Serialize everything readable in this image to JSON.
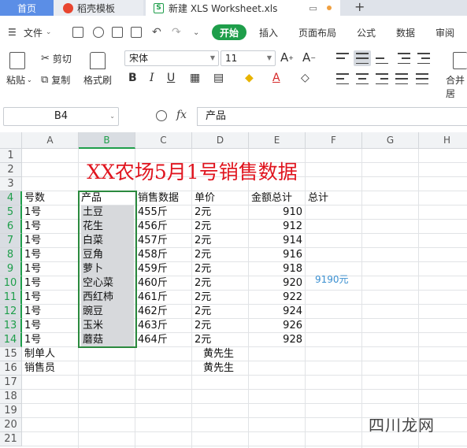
{
  "tabs": {
    "home": "首页",
    "template": "稻壳模板",
    "document": "新建 XLS Worksheet.xls"
  },
  "menu": {
    "file": "文件",
    "items": [
      "开始",
      "插入",
      "页面布局",
      "公式",
      "数据",
      "审阅"
    ]
  },
  "ribbon": {
    "paste": "粘贴",
    "cut": "剪切",
    "copy": "复制",
    "format_painter": "格式刷",
    "font_name": "宋体",
    "font_size": "11",
    "merge": "合并居"
  },
  "formula_bar": {
    "cell_ref": "B4",
    "fx": "fx",
    "content": "产品"
  },
  "columns": [
    "A",
    "B",
    "C",
    "D",
    "E",
    "F",
    "G",
    "H"
  ],
  "rows": [
    "1",
    "2",
    "3",
    "4",
    "5",
    "6",
    "7",
    "8",
    "9",
    "10",
    "11",
    "12",
    "13",
    "14",
    "15",
    "16",
    "17",
    "18",
    "19",
    "20",
    "21"
  ],
  "sheet": {
    "title": "XX农场5月1号销售数据",
    "headers": [
      "号数",
      "产品",
      "销售数据",
      "单价",
      "金额总计",
      "总计"
    ],
    "records": [
      [
        "1号",
        "土豆",
        "455斤",
        "2元",
        "910"
      ],
      [
        "1号",
        "花生",
        "456斤",
        "2元",
        "912"
      ],
      [
        "1号",
        "白菜",
        "457斤",
        "2元",
        "914"
      ],
      [
        "1号",
        "豆角",
        "458斤",
        "2元",
        "916"
      ],
      [
        "1号",
        "萝卜",
        "459斤",
        "2元",
        "918"
      ],
      [
        "1号",
        "空心菜",
        "460斤",
        "2元",
        "920"
      ],
      [
        "1号",
        "西红柿",
        "461斤",
        "2元",
        "922"
      ],
      [
        "1号",
        "豌豆",
        "462斤",
        "2元",
        "924"
      ],
      [
        "1号",
        "玉米",
        "463斤",
        "2元",
        "926"
      ],
      [
        "1号",
        "蘑菇",
        "464斤",
        "2元",
        "928"
      ]
    ],
    "grand_total": "9190元",
    "footer": [
      {
        "label": "制单人",
        "value": "黄先生"
      },
      {
        "label": "销售员",
        "value": "黄先生"
      }
    ]
  },
  "watermark": "四川龙网",
  "colors": {
    "accent": "#1e9e4a",
    "title": "#e0141e",
    "total": "#3a8fd0"
  }
}
